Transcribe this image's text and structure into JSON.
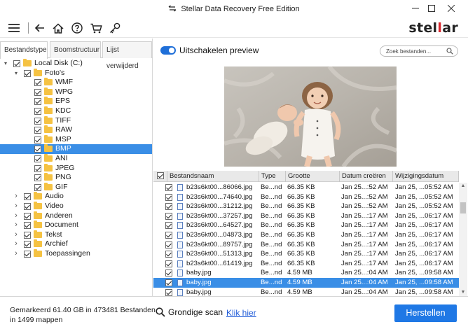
{
  "window": {
    "title": "Stellar Data Recovery Free Edition",
    "brand_prefix": "stel",
    "brand_accent": "l",
    "brand_suffix": "ar",
    "accent_color": "#d9242b",
    "primary_color": "#1f78e5"
  },
  "toolbar": {
    "icons": [
      "menu-icon",
      "back-icon",
      "home-icon",
      "help-icon",
      "cart-icon",
      "key-icon"
    ]
  },
  "left_panel": {
    "tabs": [
      "Bestandstype",
      "Boomstructuur",
      "Lijst verwijderd"
    ],
    "active_tab": "Bestandstype",
    "tree": [
      {
        "label": "Local Disk (C:)",
        "level": 0,
        "expanded": true,
        "checked": true,
        "selected": false
      },
      {
        "label": "Foto's",
        "level": 1,
        "expanded": true,
        "checked": true,
        "selected": false
      },
      {
        "label": "WMF",
        "level": 2,
        "checked": true,
        "selected": false
      },
      {
        "label": "WPG",
        "level": 2,
        "checked": true,
        "selected": false
      },
      {
        "label": "EPS",
        "level": 2,
        "checked": true,
        "selected": false
      },
      {
        "label": "KDC",
        "level": 2,
        "checked": true,
        "selected": false
      },
      {
        "label": "TIFF",
        "level": 2,
        "checked": true,
        "selected": false
      },
      {
        "label": "RAW",
        "level": 2,
        "checked": true,
        "selected": false
      },
      {
        "label": "MSP",
        "level": 2,
        "checked": true,
        "selected": false
      },
      {
        "label": "BMP",
        "level": 2,
        "checked": true,
        "selected": true
      },
      {
        "label": "ANI",
        "level": 2,
        "checked": true,
        "selected": false
      },
      {
        "label": "JPEG",
        "level": 2,
        "checked": true,
        "selected": false
      },
      {
        "label": "PNG",
        "level": 2,
        "checked": true,
        "selected": false
      },
      {
        "label": "GIF",
        "level": 2,
        "checked": true,
        "selected": false
      },
      {
        "label": "Audio",
        "level": 1,
        "expanded": false,
        "checked": true,
        "selected": false
      },
      {
        "label": "Video",
        "level": 1,
        "expanded": false,
        "checked": true,
        "selected": false
      },
      {
        "label": "Anderen",
        "level": 1,
        "expanded": false,
        "checked": true,
        "selected": false
      },
      {
        "label": "Document",
        "level": 1,
        "expanded": false,
        "checked": true,
        "selected": false
      },
      {
        "label": "Tekst",
        "level": 1,
        "expanded": false,
        "checked": true,
        "selected": false
      },
      {
        "label": "Archief",
        "level": 1,
        "expanded": false,
        "checked": true,
        "selected": false
      },
      {
        "label": "Toepassingen",
        "level": 1,
        "expanded": false,
        "checked": true,
        "selected": false
      }
    ]
  },
  "preview": {
    "toggle_label": "Uitschakelen preview",
    "toggle_on": true,
    "search_placeholder": "Zoek bestanden..."
  },
  "file_table": {
    "columns": [
      "Bestandsnaam",
      "Type",
      "Grootte",
      "Datum creëren",
      "Wijzigingsdatum"
    ],
    "rows": [
      {
        "name": "b23s6kt00...86066.jpg",
        "type": "Be...nd",
        "size": "66.35 KB",
        "created": "Jan 25...:52 AM",
        "modified": "Jan 25, ...05:52 AM",
        "selected": false
      },
      {
        "name": "b23s6kt00...74640.jpg",
        "type": "Be...nd",
        "size": "66.35 KB",
        "created": "Jan 25...:52 AM",
        "modified": "Jan 25, ...05:52 AM",
        "selected": false
      },
      {
        "name": "b23s6kt00...31212.jpg",
        "type": "Be...nd",
        "size": "66.35 KB",
        "created": "Jan 25...:52 AM",
        "modified": "Jan 25, ...05:52 AM",
        "selected": false
      },
      {
        "name": "b23s6kt00...37257.jpg",
        "type": "Be...nd",
        "size": "66.35 KB",
        "created": "Jan 25...:17 AM",
        "modified": "Jan 25, ...06:17 AM",
        "selected": false
      },
      {
        "name": "b23s6kt00...64527.jpg",
        "type": "Be...nd",
        "size": "66.35 KB",
        "created": "Jan 25...:17 AM",
        "modified": "Jan 25, ...06:17 AM",
        "selected": false
      },
      {
        "name": "b23s6kt00...04873.jpg",
        "type": "Be...nd",
        "size": "66.35 KB",
        "created": "Jan 25...:17 AM",
        "modified": "Jan 25, ...06:17 AM",
        "selected": false
      },
      {
        "name": "b23s6kt00...89757.jpg",
        "type": "Be...nd",
        "size": "66.35 KB",
        "created": "Jan 25...:17 AM",
        "modified": "Jan 25, ...06:17 AM",
        "selected": false
      },
      {
        "name": "b23s6kt00...51313.jpg",
        "type": "Be...nd",
        "size": "66.35 KB",
        "created": "Jan 25...:17 AM",
        "modified": "Jan 25, ...06:17 AM",
        "selected": false
      },
      {
        "name": "b23s6kt00...61419.jpg",
        "type": "Be...nd",
        "size": "66.35 KB",
        "created": "Jan 25...:17 AM",
        "modified": "Jan 25, ...06:17 AM",
        "selected": false
      },
      {
        "name": "baby.jpg",
        "type": "Be...nd",
        "size": "4.59 MB",
        "created": "Jan 25...:04 AM",
        "modified": "Jan 25, ...09:58 AM",
        "selected": false
      },
      {
        "name": "baby.jpg",
        "type": "Be...nd",
        "size": "4.59 MB",
        "created": "Jan 25...:04 AM",
        "modified": "Jan 25, ...09:58 AM",
        "selected": true
      },
      {
        "name": "baby.jpg",
        "type": "Be...nd",
        "size": "4.59 MB",
        "created": "Jan 25...:04 AM",
        "modified": "Jan 25, ...09:58 AM",
        "selected": false
      }
    ]
  },
  "footer": {
    "summary_line1": "Gemarkeerd 61.40 GB in 473481 Bestanden",
    "summary_line2": "in 1499 mappen",
    "deep_scan_label": "Grondige scan",
    "click_here": "Klik hier",
    "recover_button": "Herstellen"
  }
}
